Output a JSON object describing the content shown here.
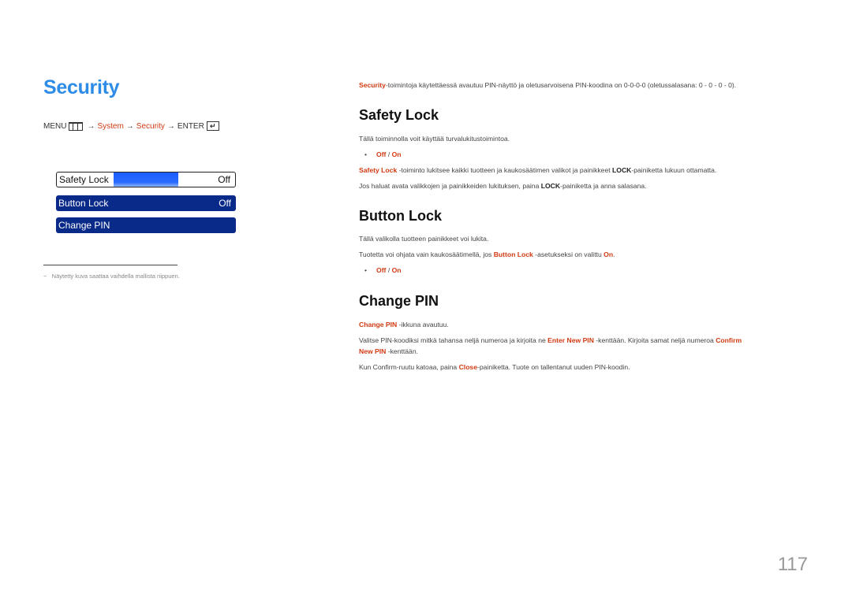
{
  "left": {
    "title": "Security",
    "menu_path": {
      "menu": "MENU",
      "menu_icon": "menu-grid-icon",
      "arrow": "→",
      "system": "System",
      "security": "Security",
      "enter": "ENTER",
      "enter_icon": "enter-icon",
      "enter_glyph": "↵"
    },
    "osd": {
      "safety_lock": {
        "label": "Safety Lock",
        "value": "Off"
      },
      "button_lock": {
        "label": "Button Lock",
        "value": "Off"
      },
      "change_pin": {
        "label": "Change PIN"
      }
    },
    "footnote": "Näytetty kuva saattaa vaihdella mallista riippuen.",
    "footnote_dash": "−"
  },
  "intro": {
    "highlight": "Security",
    "text": "-toimintoja käytettäessä avautuu PIN-näyttö ja oletusarvoisena PIN-koodina on 0-0-0-0 (oletussalasana: 0 - 0 - 0 - 0)."
  },
  "safety_lock": {
    "heading": "Safety Lock",
    "desc": "Tällä toiminnolla voit käyttää turvalukitustoimintoa.",
    "options": {
      "off": "Off",
      "sep": " / ",
      "on": "On"
    },
    "p1": {
      "highlight": "Safety Lock",
      "text1": " -toiminto lukitsee kaikki tuotteen ja kaukosäätimen valikot ja painikkeet ",
      "bold": "LOCK",
      "text2": "-painiketta lukuun ottamatta."
    },
    "p2": {
      "text1": "Jos haluat avata valikkojen ja painikkeiden lukituksen, paina ",
      "bold": "LOCK",
      "text2": "-painiketta ja anna salasana."
    }
  },
  "button_lock": {
    "heading": "Button Lock",
    "desc": "Tällä valikolla tuotteen painikkeet voi lukita.",
    "p1": {
      "text1": "Tuotetta voi ohjata vain kaukosäätimellä, jos ",
      "highlight": "Button Lock",
      "text2": " -asetukseksi on valittu ",
      "on": "On",
      "end": "."
    },
    "options": {
      "off": "Off",
      "sep": " / ",
      "on": "On"
    }
  },
  "change_pin": {
    "heading": "Change PIN",
    "p1": {
      "highlight": "Change PIN",
      "text": " -ikkuna avautuu."
    },
    "p2": {
      "text1": "Valitse PIN-koodiksi mitkä tahansa neljä numeroa ja kirjoita ne ",
      "h1": "Enter New PIN",
      "text2": " -kenttään. Kirjoita samat neljä numeroa ",
      "h2a": "Confirm",
      "h2b": "New PIN",
      "text3": " -kenttään."
    },
    "p3": {
      "text1": "Kun Confirm-ruutu katoaa, paina ",
      "h": "Close",
      "text2": "-painiketta. Tuote on tallentanut uuden PIN-koodin."
    }
  },
  "page_number": "117",
  "colors": {
    "title_blue": "#2d8ce8",
    "highlight_red": "#d03a12",
    "osd_navy": "#0a2a8a",
    "osd_select_blue": "#1a5cff"
  }
}
